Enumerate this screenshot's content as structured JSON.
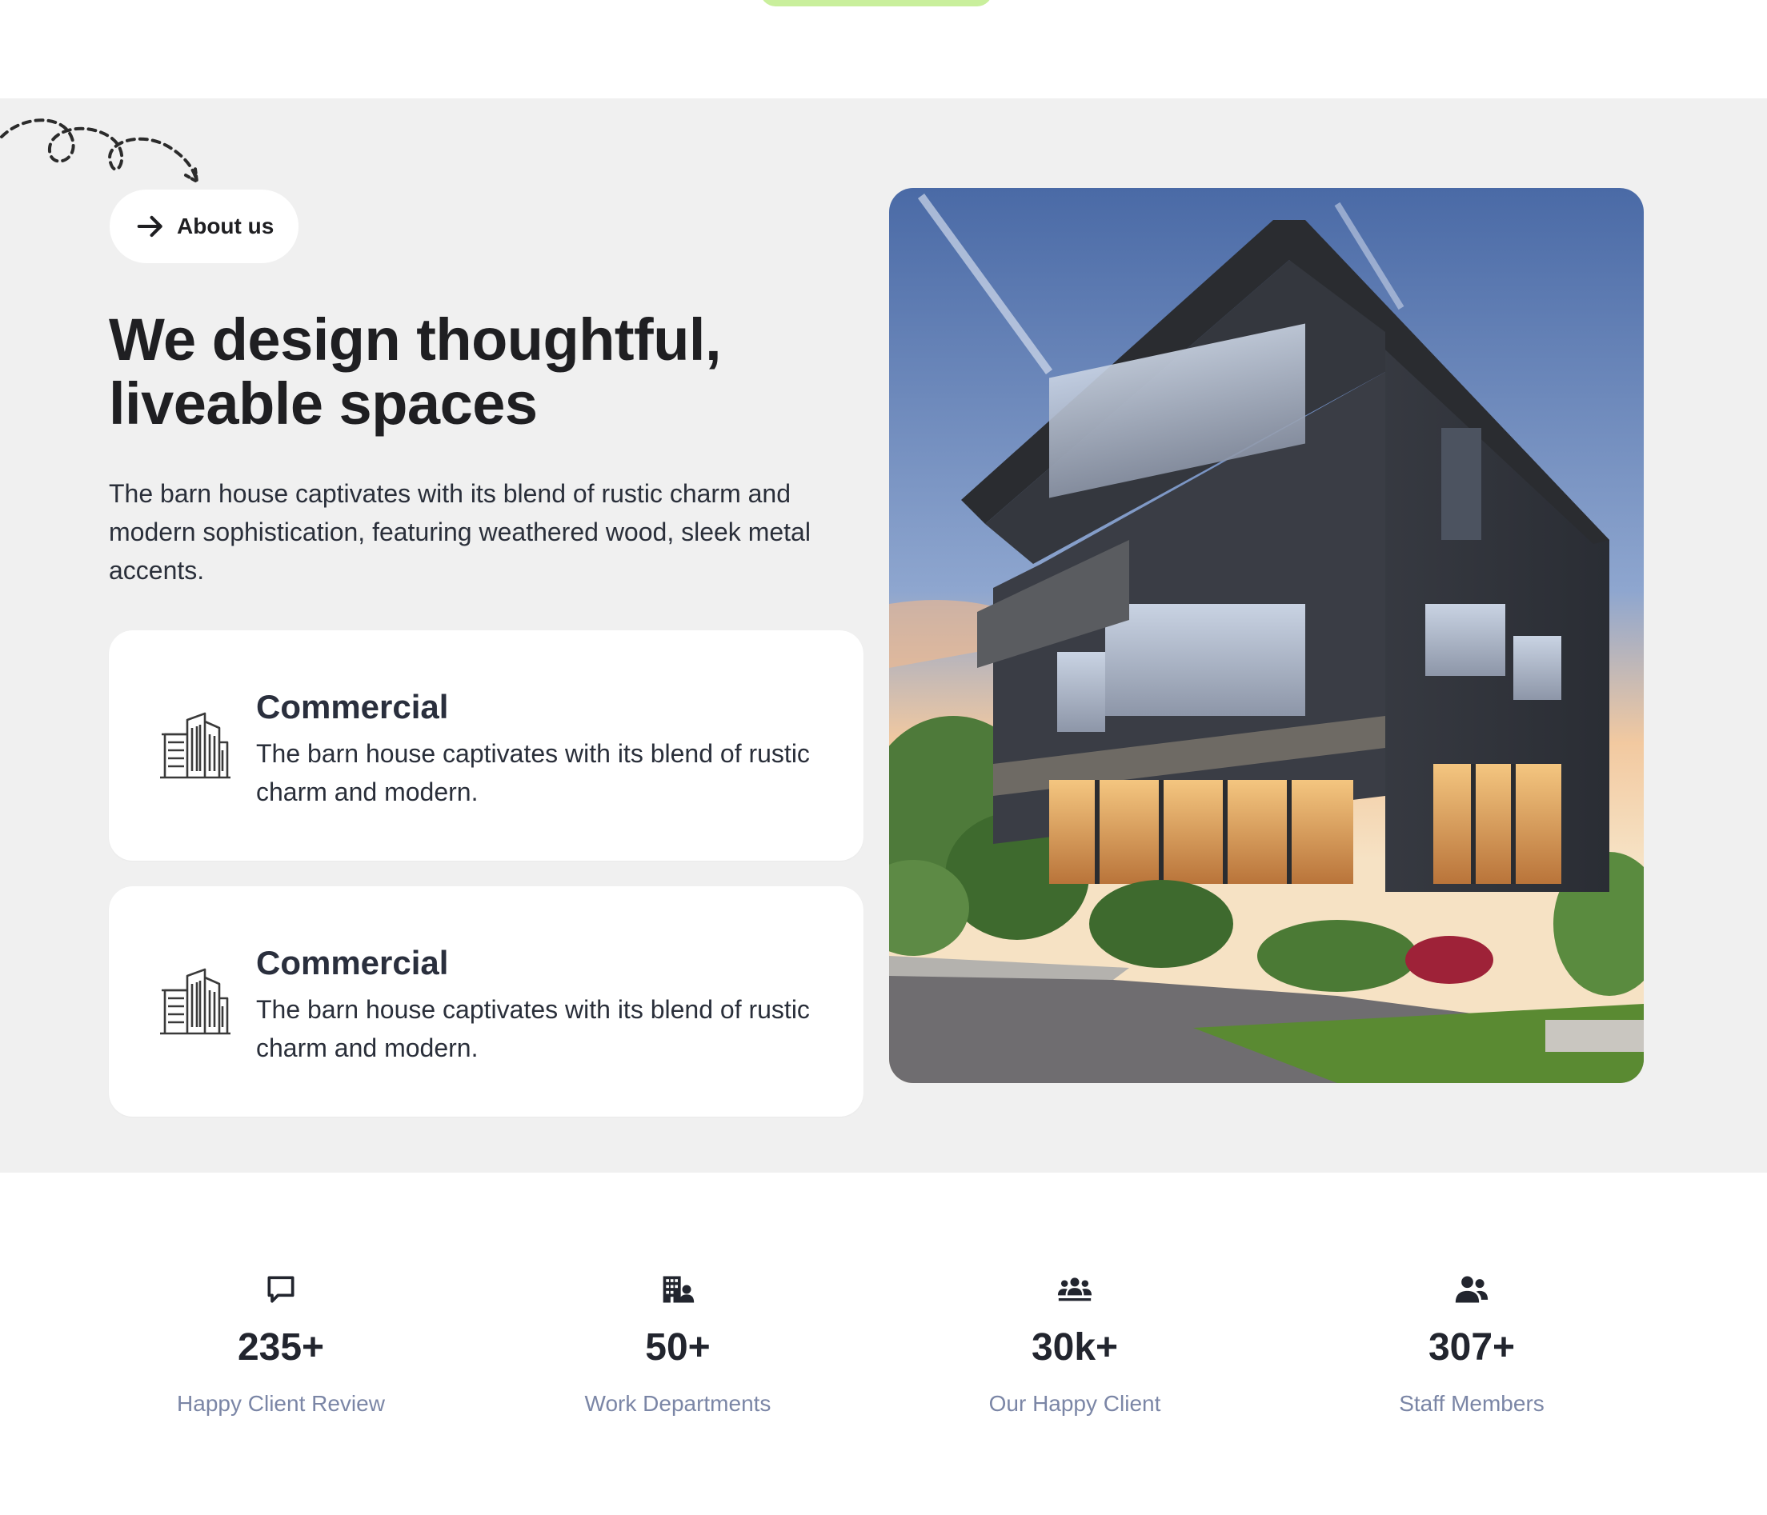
{
  "about": {
    "badge_label": "About us",
    "headline_line1": "We design thoughtful,",
    "headline_line2": "liveable spaces",
    "intro": "The barn house captivates with its blend of rustic charm and modern sophistication, featuring weathered wood, sleek metal accents.",
    "cards": [
      {
        "icon": "buildings-icon",
        "title": "Commercial",
        "description": "The barn house captivates with its blend of rustic charm and modern."
      },
      {
        "icon": "buildings-icon",
        "title": "Commercial",
        "description": "The barn house captivates with its blend of rustic charm and modern."
      }
    ],
    "image": "modern-house-photo"
  },
  "stats": [
    {
      "icon": "chat-bubble-icon",
      "value": "235+",
      "label": "Happy Client Review"
    },
    {
      "icon": "building-user-icon",
      "value": "50+",
      "label": "Work Departments"
    },
    {
      "icon": "users-group-icon",
      "value": "30k+",
      "label": "Our Happy Client"
    },
    {
      "icon": "user-friends-icon",
      "value": "307+",
      "label": "Staff Members"
    }
  ],
  "colors": {
    "section_bg": "#f0f0f0",
    "accent_green": "#c9ef9c",
    "heading": "#1f1f22",
    "stat_label": "#7b86a6"
  }
}
